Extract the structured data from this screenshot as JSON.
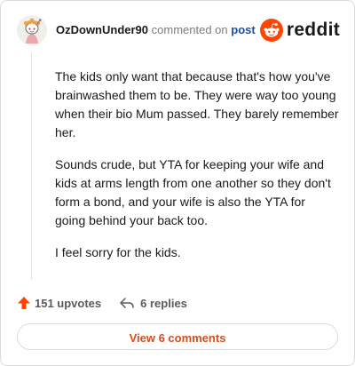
{
  "comment": {
    "username": "OzDownUnder90",
    "action_text": "commented on",
    "post_link_text": "post",
    "paragraphs": [
      "The kids only want that because that's how you've brainwashed them to be. They were way too young when their bio Mum passed. They barely remember her.",
      "Sounds crude, but YTA for keeping your wife and kids at arms length from one another so they don't form a bond, and your wife is also the YTA for going behind your back too.",
      "I feel sorry for the kids."
    ],
    "upvotes_label": "151 upvotes",
    "replies_label": "6 replies",
    "view_comments_label": "View 6 comments"
  },
  "brand": {
    "logo_text": "reddit",
    "accent_color": "#ff4500",
    "link_color": "#1c4fa3",
    "button_text_color": "#d44f1c"
  },
  "icons": {
    "avatar": "snoo-avatar",
    "logo": "reddit-alien-icon",
    "upvote": "upvote-arrow-icon",
    "reply": "reply-arrow-icon"
  }
}
